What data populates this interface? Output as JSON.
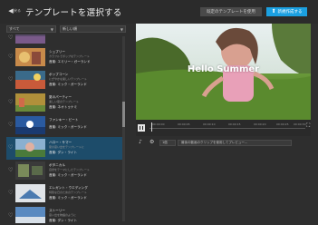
{
  "header": {
    "back_label": "戻る",
    "title": "テンプレートを選択する",
    "default_button": "既定のテンプレートを使用",
    "create_button": "新規作成する"
  },
  "filters": {
    "category": "すべて",
    "sort": "新しい順"
  },
  "templates": [
    {
      "name": "",
      "desc": "",
      "artist": ""
    },
    {
      "name": "シュプリー",
      "desc": "カラフルでポップなテンプレート",
      "artist": "音楽: エミリー・ガーランド"
    },
    {
      "name": "ポップコーン",
      "desc": "にぎやかな楽しいテンプレート",
      "artist": "音楽: ミック・ガーランド"
    },
    {
      "name": "夏のパーティー",
      "desc": "楽しい夏のテンプレート",
      "artist": "音楽: ネオトゥナミ"
    },
    {
      "name": "ファンキー・ビート",
      "desc": "",
      "artist": "音楽: ミック・ガーランド"
    },
    {
      "name": "ハロー・サマー",
      "desc": "夏の思い出をテンプレートに",
      "artist": "音楽: ダン・ライト"
    },
    {
      "name": "ボタニカル",
      "desc": "自然をテーマにしたテンプレート",
      "artist": "音楽: ミック・ガーランド"
    },
    {
      "name": "エレガント・ウエディング",
      "desc": "特別な日のためのテンプレート",
      "artist": "音楽: ミック・ガーランド"
    },
    {
      "name": "ストーリー",
      "desc": "思い出を物語のように",
      "artist": "音楽: ダン・ライト"
    }
  ],
  "preview": {
    "caption": "Hello Summer",
    "timeline_ticks": [
      "00:00:00",
      "00:00:05",
      "00:00:10",
      "00:00:15",
      "00:00:20",
      "00:00:25",
      "00:00:30"
    ],
    "speed_value": "1倍",
    "text_placeholder": "最後の動画のクリップを使用してプレビュー..."
  },
  "colors": {
    "accent": "#1ba0e1",
    "selected_row": "#1d4c6a"
  }
}
